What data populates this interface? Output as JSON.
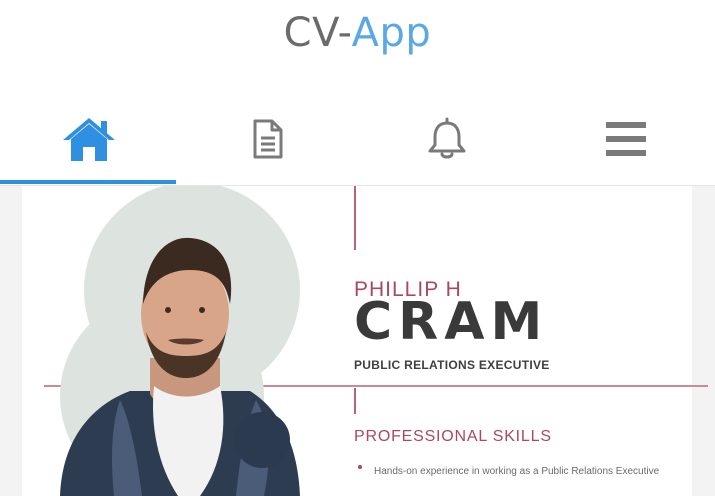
{
  "header": {
    "title_part1": "CV-",
    "title_part2": "App",
    "accent_color": "#5aa9e6"
  },
  "tabs": [
    {
      "icon": "home-icon",
      "active": true
    },
    {
      "icon": "document-icon",
      "active": false
    },
    {
      "icon": "bell-icon",
      "active": false
    },
    {
      "icon": "menu-icon",
      "active": false
    }
  ],
  "resume": {
    "first_name": "PHILLIP H",
    "last_name": "CRAM",
    "job_title": "PUBLIC RELATIONS EXECUTIVE",
    "skills_heading": "PROFESSIONAL SKILLS",
    "skills": [
      "Hands-on experience in working as a Public Relations Executive"
    ],
    "accent_color": "#a9485f"
  }
}
